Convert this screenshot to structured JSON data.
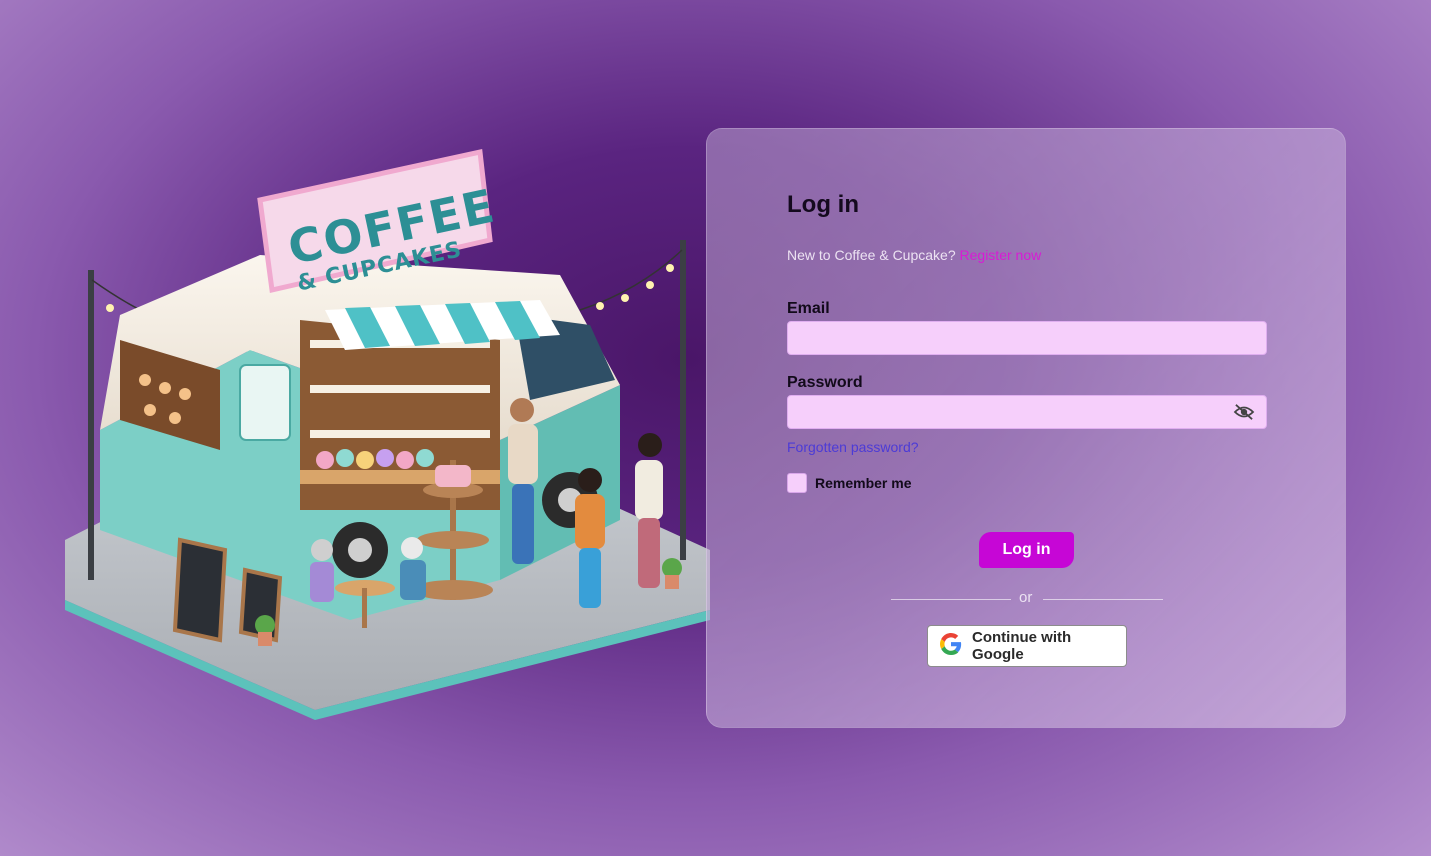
{
  "illustration": {
    "sign_line_1": "COFFEE",
    "sign_line_2": "& CUPCAKES",
    "truck_panel": "COFFEE"
  },
  "login": {
    "title": "Log in",
    "subtitle_text": "New to Coffee & Cupcake?",
    "register_link": "Register now",
    "email_label": "Email",
    "email_value": "",
    "password_label": "Password",
    "password_value": "",
    "forgot_link": "Forgotten password?",
    "remember_label": "Remember me",
    "remember_checked": false,
    "submit_label": "Log in",
    "divider_text": "or",
    "google_label": "Continue with Google"
  },
  "icons": {
    "password_toggle": "eye-slash-icon",
    "google": "google-g-icon"
  },
  "colors": {
    "accent": "#c606d6",
    "link_register": "#d81bd4",
    "link_forgot": "#4c3bd6",
    "input_bg": "#f6cffb",
    "truck_teal": "#6cc8bf"
  }
}
